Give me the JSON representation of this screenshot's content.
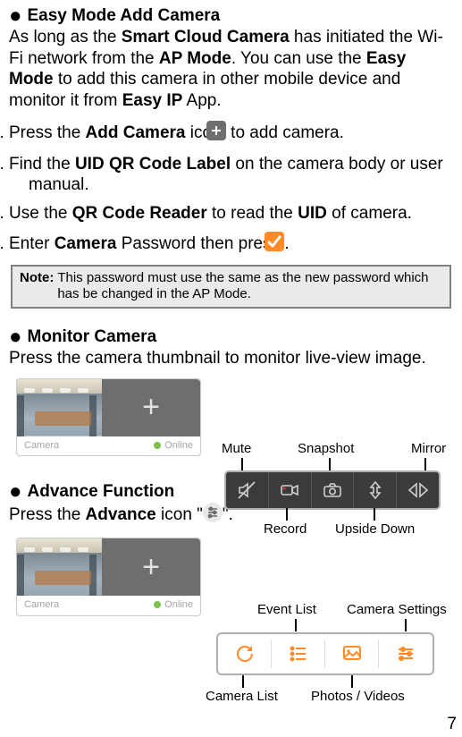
{
  "sec1": {
    "heading": "Easy Mode Add Camera",
    "para_parts": {
      "a": "As long as the ",
      "b": "Smart Cloud Camera",
      "c": " has initiated the Wi-Fi network from the ",
      "d": "AP Mode",
      "e": ".    You can use the ",
      "f": "Easy Mode",
      "g": " to add this camera in other mobile device and monitor it from ",
      "h": "Easy IP",
      "i": " App."
    },
    "steps": {
      "s1": {
        "a": "Press the ",
        "b": "Add Camera",
        "c": " icon ",
        "d": " to add camera."
      },
      "s2": {
        "a": "Find the ",
        "b": "UID QR Code Label",
        "c": " on the camera body or user manual."
      },
      "s3": {
        "a": "Use the ",
        "b": "QR Code Reader",
        "c": " to read the ",
        "d": "UID",
        "e": " of camera."
      },
      "s4": {
        "a": "Enter ",
        "b": "Camera",
        "c": " Password then press ",
        "d": "."
      }
    },
    "note": {
      "label": "Note:",
      "text": "This password must use the same as the new password which has be changed in the AP Mode."
    }
  },
  "sec2": {
    "heading": "Monitor Camera",
    "para": "Press the camera thumbnail to monitor live-view image.",
    "thumb": {
      "name": "Camera",
      "status": "Online",
      "add": "+"
    },
    "labels": {
      "mute": "Mute",
      "snapshot": "Snapshot",
      "mirror": "Mirror",
      "record": "Record",
      "upside": "Upside Down"
    }
  },
  "sec3": {
    "heading": "Advance Function",
    "para": {
      "a": "Press the ",
      "b": "Advance",
      "c": " icon \"",
      "d": "\"."
    },
    "thumb": {
      "name": "Camera",
      "status": "Online",
      "add": "+"
    },
    "labels": {
      "event": "Event List",
      "settings": "Camera Settings",
      "camlist": "Camera List",
      "photos": "Photos / Videos"
    }
  },
  "page": "7"
}
